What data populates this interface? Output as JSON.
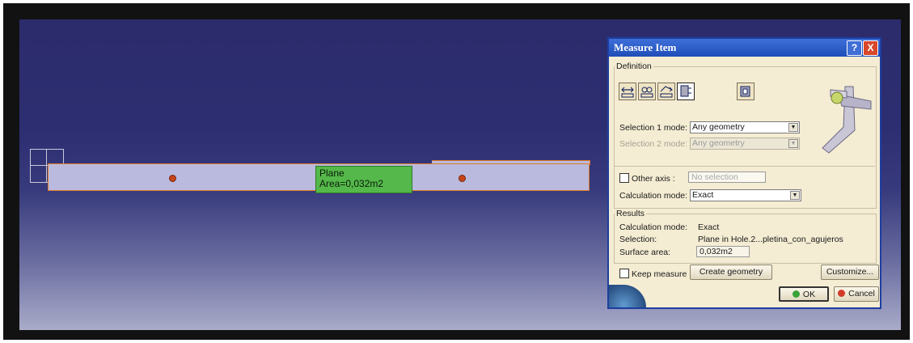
{
  "viewport": {
    "label": {
      "line1": "Plane",
      "line2": "Area=0,032m2"
    }
  },
  "dialog": {
    "title": "Measure Item",
    "help_icon": "?",
    "close_icon": "X",
    "definition": {
      "legend": "Definition",
      "selection1_label": "Selection 1 mode:",
      "selection1_value": "Any geometry",
      "selection2_label": "Selection 2 mode:",
      "selection2_value": "Any geometry",
      "other_axis_label": "Other axis :",
      "other_axis_value": "No selection",
      "calc_mode_label": "Calculation mode:",
      "calc_mode_value": "Exact"
    },
    "results": {
      "legend": "Results",
      "calc_mode_label": "Calculation mode:",
      "calc_mode_value": "Exact",
      "selection_label": "Selection:",
      "selection_value": "Plane in Hole.2...pletina_con_agujeros",
      "surface_label": "Surface area:",
      "surface_value": "0,032m2"
    },
    "keep_measure_label": "Keep measure",
    "create_geometry_label": "Create geometry",
    "customize_label": "Customize...",
    "ok_label": "OK",
    "cancel_label": "Cancel"
  },
  "colors": {
    "part_fill": "#b9bade",
    "part_edge": "#e07a2a",
    "label_fill": "#55b84a",
    "title_blue": "#2a58c8"
  }
}
